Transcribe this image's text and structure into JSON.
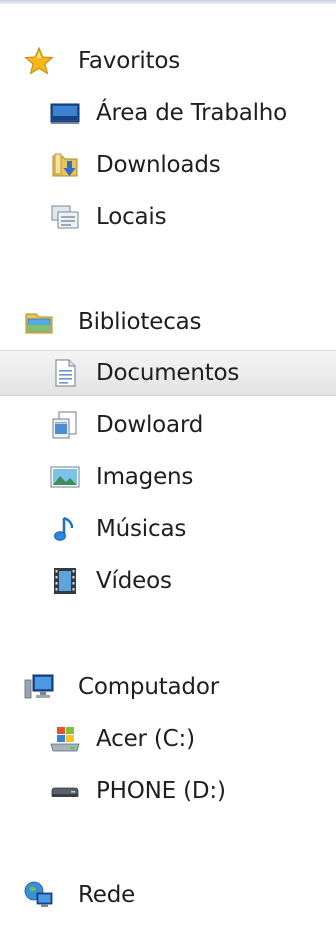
{
  "navigation_pane": {
    "favorites": {
      "label": "Favoritos",
      "icon": "star-icon",
      "items": [
        {
          "label": "Área de Trabalho",
          "icon": "desktop-icon"
        },
        {
          "label": "Downloads",
          "icon": "downloads-folder-icon"
        },
        {
          "label": "Locais",
          "icon": "recent-places-icon"
        }
      ]
    },
    "libraries": {
      "label": "Bibliotecas",
      "icon": "libraries-folder-icon",
      "items": [
        {
          "label": "Documentos",
          "icon": "document-icon",
          "selected": true
        },
        {
          "label": "Dowloard",
          "icon": "document-library-icon"
        },
        {
          "label": "Imagens",
          "icon": "image-icon"
        },
        {
          "label": "Músicas",
          "icon": "music-note-icon"
        },
        {
          "label": "Vídeos",
          "icon": "film-icon"
        }
      ]
    },
    "computer": {
      "label": "Computador",
      "icon": "computer-icon",
      "items": [
        {
          "label": "Acer (C:)",
          "icon": "windows-drive-icon"
        },
        {
          "label": "PHONE (D:)",
          "icon": "removable-drive-icon"
        }
      ]
    },
    "network": {
      "label": "Rede",
      "icon": "network-icon"
    }
  },
  "colors": {
    "selection_background": "#e6e6e6",
    "text": "#1e1e1e",
    "star": "#f4b619",
    "folder": "#e9c25a"
  }
}
